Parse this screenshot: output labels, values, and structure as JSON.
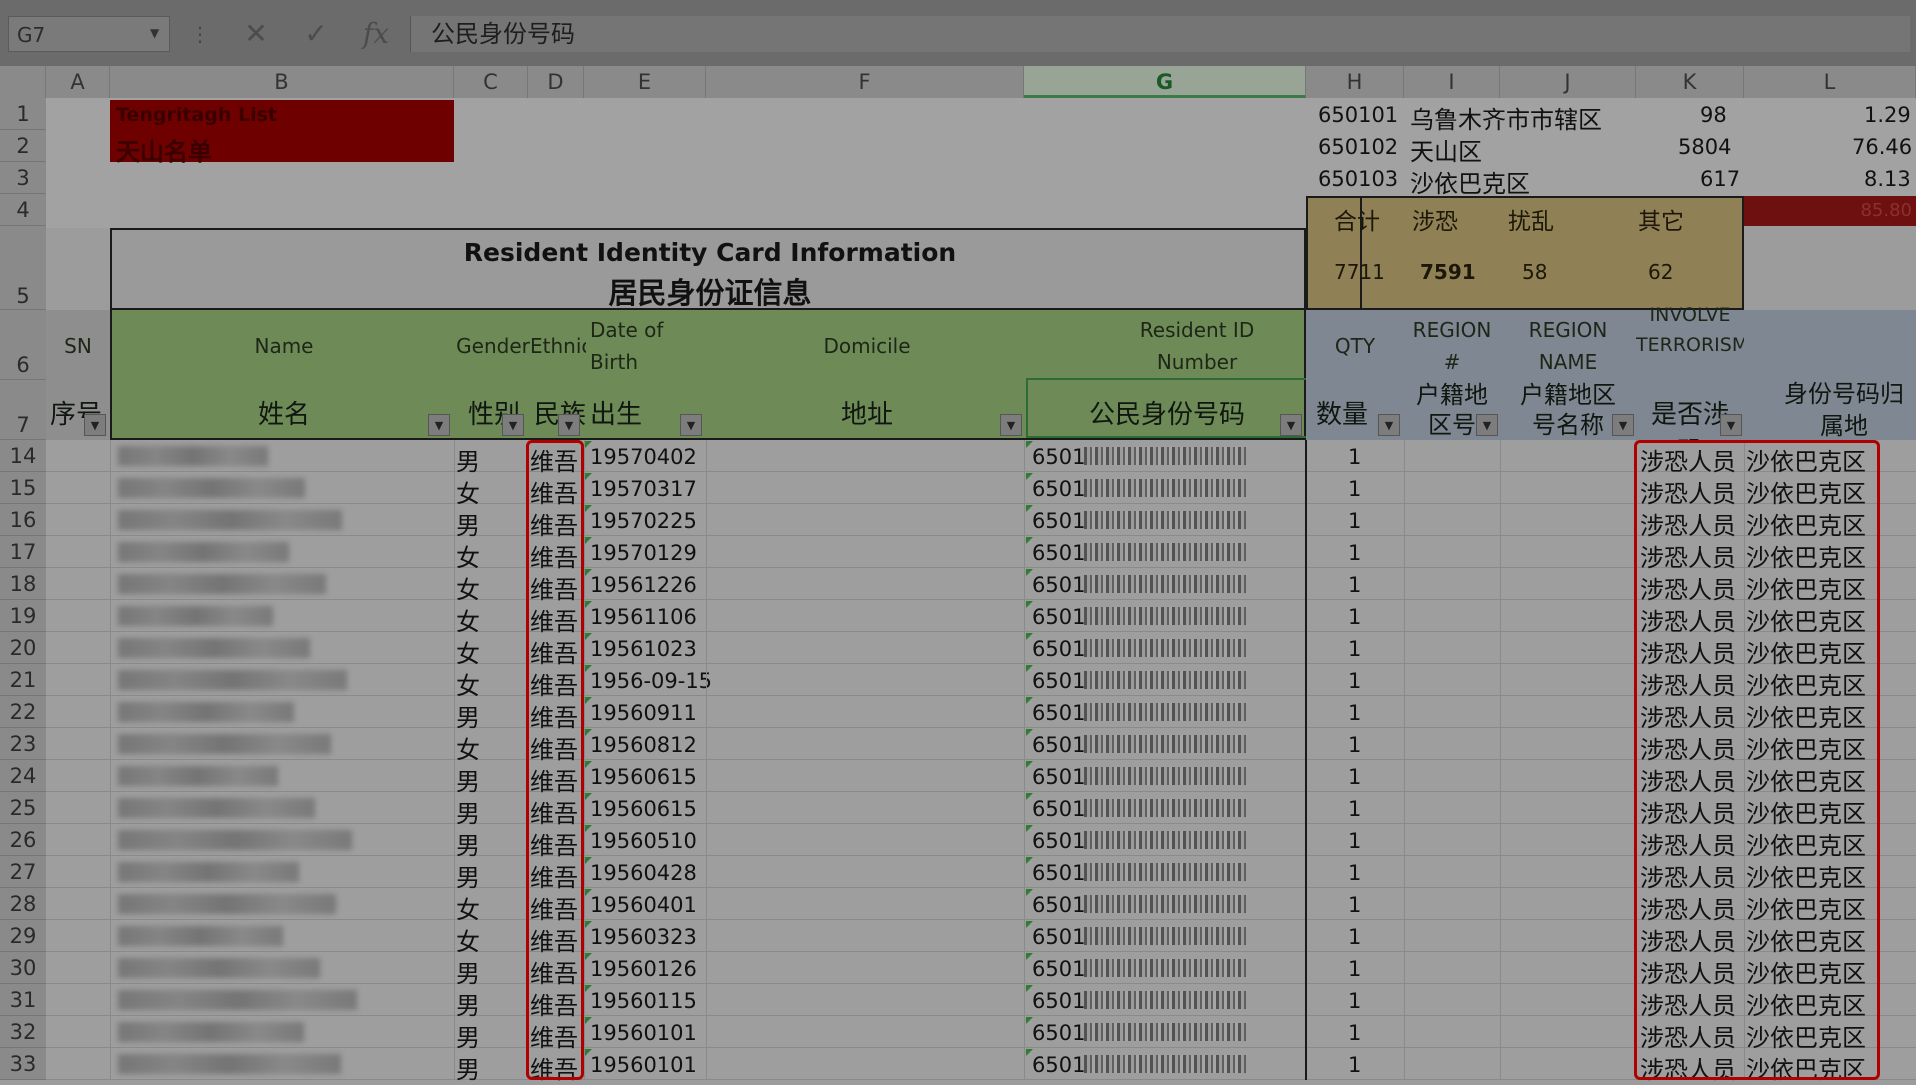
{
  "formula_bar": {
    "name_box": "G7",
    "separator_icon": "⋮",
    "cancel_icon": "✕",
    "confirm_icon": "✓",
    "fx_icon": "fx",
    "content": "公民身份号码"
  },
  "columns": [
    "A",
    "B",
    "C",
    "D",
    "E",
    "F",
    "G",
    "H",
    "I",
    "J",
    "K",
    "L"
  ],
  "selected_column": "G",
  "top_rows": {
    "row1": {
      "code": "650101",
      "name": "乌鲁木齐市市辖区",
      "k": "98",
      "l": "1.29"
    },
    "row2": {
      "code": "650102",
      "name": "天山区",
      "k": "5804",
      "l": "76.46"
    },
    "row3": {
      "code": "650103",
      "name": "沙依巴克区",
      "k": "617",
      "l": "8.13"
    }
  },
  "list_title_en": "Tengritagh List",
  "list_title_zh": "天山名单",
  "summary": {
    "labels": [
      "合计",
      "涉恐",
      "扰乱",
      "其它"
    ],
    "values": [
      "7711",
      "7591",
      "58",
      "62"
    ],
    "red_value": "85.80"
  },
  "card_title_en": "Resident Identity Card Information",
  "card_title_zh": "居民身份证信息",
  "headers": {
    "sn_en": "SN",
    "sn_zh": "序号",
    "name_en": "Name",
    "name_zh": "姓名",
    "gender_en": "Gender",
    "gender_zh": "性别",
    "ethnicity_en": "Ethnicit",
    "ethnicity_zh": "民族",
    "dob_en": "Date of Birth",
    "dob_zh": "出生",
    "domicile_en": "Domicile",
    "domicile_zh": "地址",
    "id_en": "Resident ID Number",
    "id_zh": "公民身份号码",
    "qty_en": "QTY",
    "qty_zh": "数量",
    "region_num_en": "REGION #",
    "region_num_zh": "户籍地区号",
    "region_name_en": "REGION NAME",
    "region_name_zh": "户籍地区号名称",
    "involve_en": "INVOLVE TERRORISM",
    "involve_zh": "是否涉恐",
    "id_origin_zh": "身份号码归属地"
  },
  "rows": [
    {
      "row": "14",
      "gender": "男",
      "ethnicity": "维吾",
      "dob": "19570402",
      "id": "6501",
      "qty": "1",
      "involve": "涉恐人员",
      "origin": "沙依巴克区"
    },
    {
      "row": "15",
      "gender": "女",
      "ethnicity": "维吾",
      "dob": "19570317",
      "id": "6501",
      "qty": "1",
      "involve": "涉恐人员",
      "origin": "沙依巴克区"
    },
    {
      "row": "16",
      "gender": "男",
      "ethnicity": "维吾",
      "dob": "19570225",
      "id": "6501",
      "qty": "1",
      "involve": "涉恐人员",
      "origin": "沙依巴克区"
    },
    {
      "row": "17",
      "gender": "女",
      "ethnicity": "维吾",
      "dob": "19570129",
      "id": "6501",
      "qty": "1",
      "involve": "涉恐人员",
      "origin": "沙依巴克区"
    },
    {
      "row": "18",
      "gender": "女",
      "ethnicity": "维吾",
      "dob": "19561226",
      "id": "6501",
      "qty": "1",
      "involve": "涉恐人员",
      "origin": "沙依巴克区"
    },
    {
      "row": "19",
      "gender": "女",
      "ethnicity": "维吾",
      "dob": "19561106",
      "id": "6501",
      "qty": "1",
      "involve": "涉恐人员",
      "origin": "沙依巴克区"
    },
    {
      "row": "20",
      "gender": "女",
      "ethnicity": "维吾",
      "dob": "19561023",
      "id": "6501",
      "qty": "1",
      "involve": "涉恐人员",
      "origin": "沙依巴克区"
    },
    {
      "row": "21",
      "gender": "女",
      "ethnicity": "维吾",
      "dob": "1956-09-15",
      "id": "6501",
      "qty": "1",
      "involve": "涉恐人员",
      "origin": "沙依巴克区"
    },
    {
      "row": "22",
      "gender": "男",
      "ethnicity": "维吾",
      "dob": "19560911",
      "id": "6501",
      "qty": "1",
      "involve": "涉恐人员",
      "origin": "沙依巴克区"
    },
    {
      "row": "23",
      "gender": "女",
      "ethnicity": "维吾",
      "dob": "19560812",
      "id": "6501",
      "qty": "1",
      "involve": "涉恐人员",
      "origin": "沙依巴克区"
    },
    {
      "row": "24",
      "gender": "男",
      "ethnicity": "维吾",
      "dob": "19560615",
      "id": "6501",
      "qty": "1",
      "involve": "涉恐人员",
      "origin": "沙依巴克区"
    },
    {
      "row": "25",
      "gender": "男",
      "ethnicity": "维吾",
      "dob": "19560615",
      "id": "6501",
      "qty": "1",
      "involve": "涉恐人员",
      "origin": "沙依巴克区"
    },
    {
      "row": "26",
      "gender": "男",
      "ethnicity": "维吾",
      "dob": "19560510",
      "id": "6501",
      "qty": "1",
      "involve": "涉恐人员",
      "origin": "沙依巴克区"
    },
    {
      "row": "27",
      "gender": "男",
      "ethnicity": "维吾",
      "dob": "19560428",
      "id": "6501",
      "qty": "1",
      "involve": "涉恐人员",
      "origin": "沙依巴克区"
    },
    {
      "row": "28",
      "gender": "女",
      "ethnicity": "维吾",
      "dob": "19560401",
      "id": "6501",
      "qty": "1",
      "involve": "涉恐人员",
      "origin": "沙依巴克区"
    },
    {
      "row": "29",
      "gender": "女",
      "ethnicity": "维吾",
      "dob": "19560323",
      "id": "6501",
      "qty": "1",
      "involve": "涉恐人员",
      "origin": "沙依巴克区"
    },
    {
      "row": "30",
      "gender": "男",
      "ethnicity": "维吾",
      "dob": "19560126",
      "id": "6501",
      "qty": "1",
      "involve": "涉恐人员",
      "origin": "沙依巴克区"
    },
    {
      "row": "31",
      "gender": "男",
      "ethnicity": "维吾",
      "dob": "19560115",
      "id": "6501",
      "qty": "1",
      "involve": "涉恐人员",
      "origin": "沙依巴克区"
    },
    {
      "row": "32",
      "gender": "男",
      "ethnicity": "维吾",
      "dob": "19560101",
      "id": "6501",
      "qty": "1",
      "involve": "涉恐人员",
      "origin": "沙依巴克区"
    },
    {
      "row": "33",
      "gender": "男",
      "ethnicity": "维吾",
      "dob": "19560101",
      "id": "6501",
      "qty": "1",
      "involve": "涉恐人员",
      "origin": "沙依巴克区"
    }
  ],
  "colors": {
    "highlight": "#b00000",
    "green_header": "#6e8a57",
    "summary_bg": "#8f8056"
  }
}
